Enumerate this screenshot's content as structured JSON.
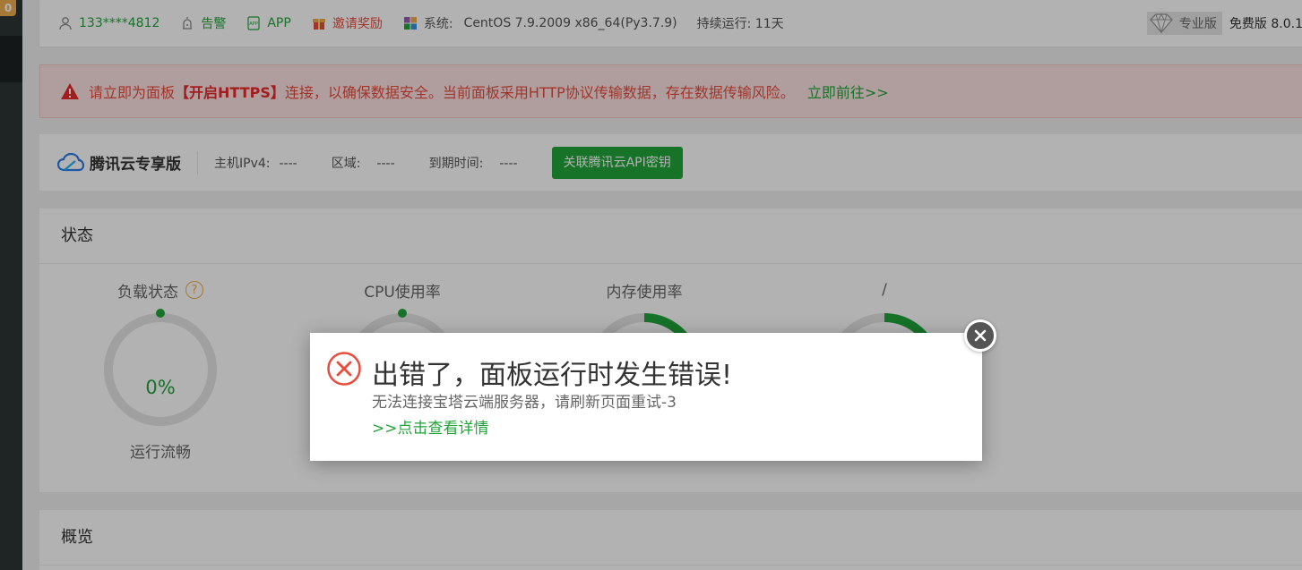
{
  "sidebar": {
    "badge": "0"
  },
  "topbar": {
    "user": "133****4812",
    "alarm": "告警",
    "app": "APP",
    "invite": "邀请奖励",
    "system_label": "系统:",
    "system_value": "CentOS 7.9.2009 x86_64(Py3.7.9)",
    "uptime": "持续运行: 11天",
    "pro_label": "专业版",
    "version": "免费版 8.0.1"
  },
  "alert": {
    "prefix": "请立即为面板",
    "highlight": "【开启HTTPS】",
    "suffix": "连接，以确保数据安全。当前面板采用HTTP协议传输数据，存在数据传输风险。",
    "link": "立即前往>>"
  },
  "tencent": {
    "brand": "腾讯云专享版",
    "ipv4_label": "主机IPv4:",
    "ipv4_value": "----",
    "region_label": "区域:",
    "region_value": "----",
    "expire_label": "到期时间:",
    "expire_value": "----",
    "button": "关联腾讯云API密钥"
  },
  "status": {
    "title": "状态",
    "gauges": [
      {
        "title": "负载状态",
        "value": "0%",
        "subtitle": "运行流畅",
        "percent": 0
      },
      {
        "title": "CPU使用率",
        "value": "",
        "subtitle": "",
        "percent": 0
      },
      {
        "title": "内存使用率",
        "value": "",
        "subtitle": "",
        "percent": 0.3
      },
      {
        "title": "/",
        "value": "",
        "subtitle": "",
        "percent": 0.3
      }
    ],
    "help_glyph": "?"
  },
  "overview": {
    "title": "概览"
  },
  "dialog": {
    "title": "出错了，面板运行时发生错误!",
    "message": "无法连接宝塔云端服务器，请刷新页面重试-3",
    "link": ">>点击查看详情"
  },
  "colors": {
    "accent": "#20a53a",
    "danger": "#e84c3d",
    "warning": "#f0ad4e"
  }
}
